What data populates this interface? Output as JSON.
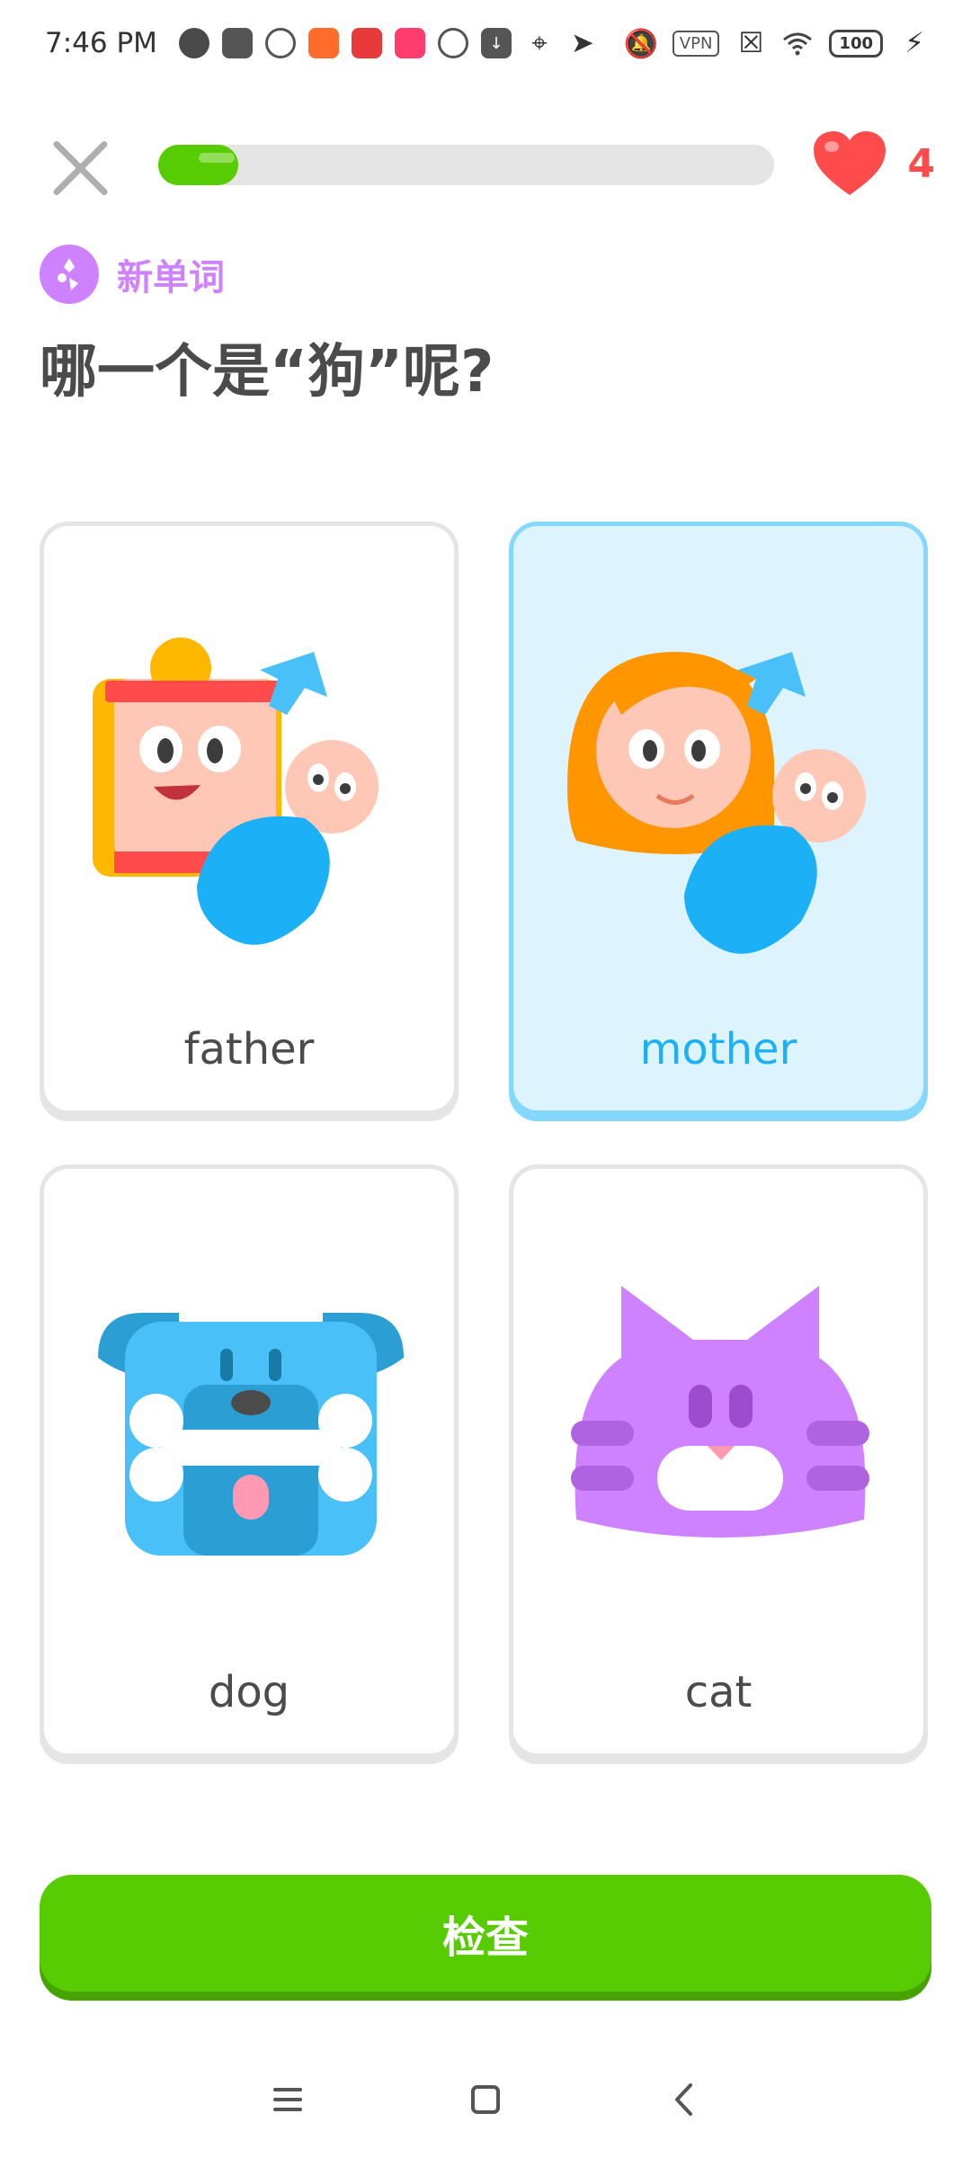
{
  "status_bar": {
    "time": "7:46 PM",
    "vpn_label": "VPN",
    "battery_level": "100"
  },
  "lesson": {
    "progress_fraction": 0.13,
    "hearts_count": "4"
  },
  "header": {
    "tag_label": "新单词",
    "question": "哪一个是“狗”呢?"
  },
  "choices": [
    {
      "label": "father",
      "icon": "father-baby-illustration",
      "selected": false
    },
    {
      "label": "mother",
      "icon": "mother-baby-illustration",
      "selected": true
    },
    {
      "label": "dog",
      "icon": "dog-illustration",
      "selected": false
    },
    {
      "label": "cat",
      "icon": "cat-illustration",
      "selected": false
    }
  ],
  "actions": {
    "check_label": "检查"
  },
  "colors": {
    "green": "#58cc02",
    "selected_blue": "#1cb0f6",
    "heart_red": "#ff4b4b",
    "tag_purple": "#ce82ff"
  }
}
